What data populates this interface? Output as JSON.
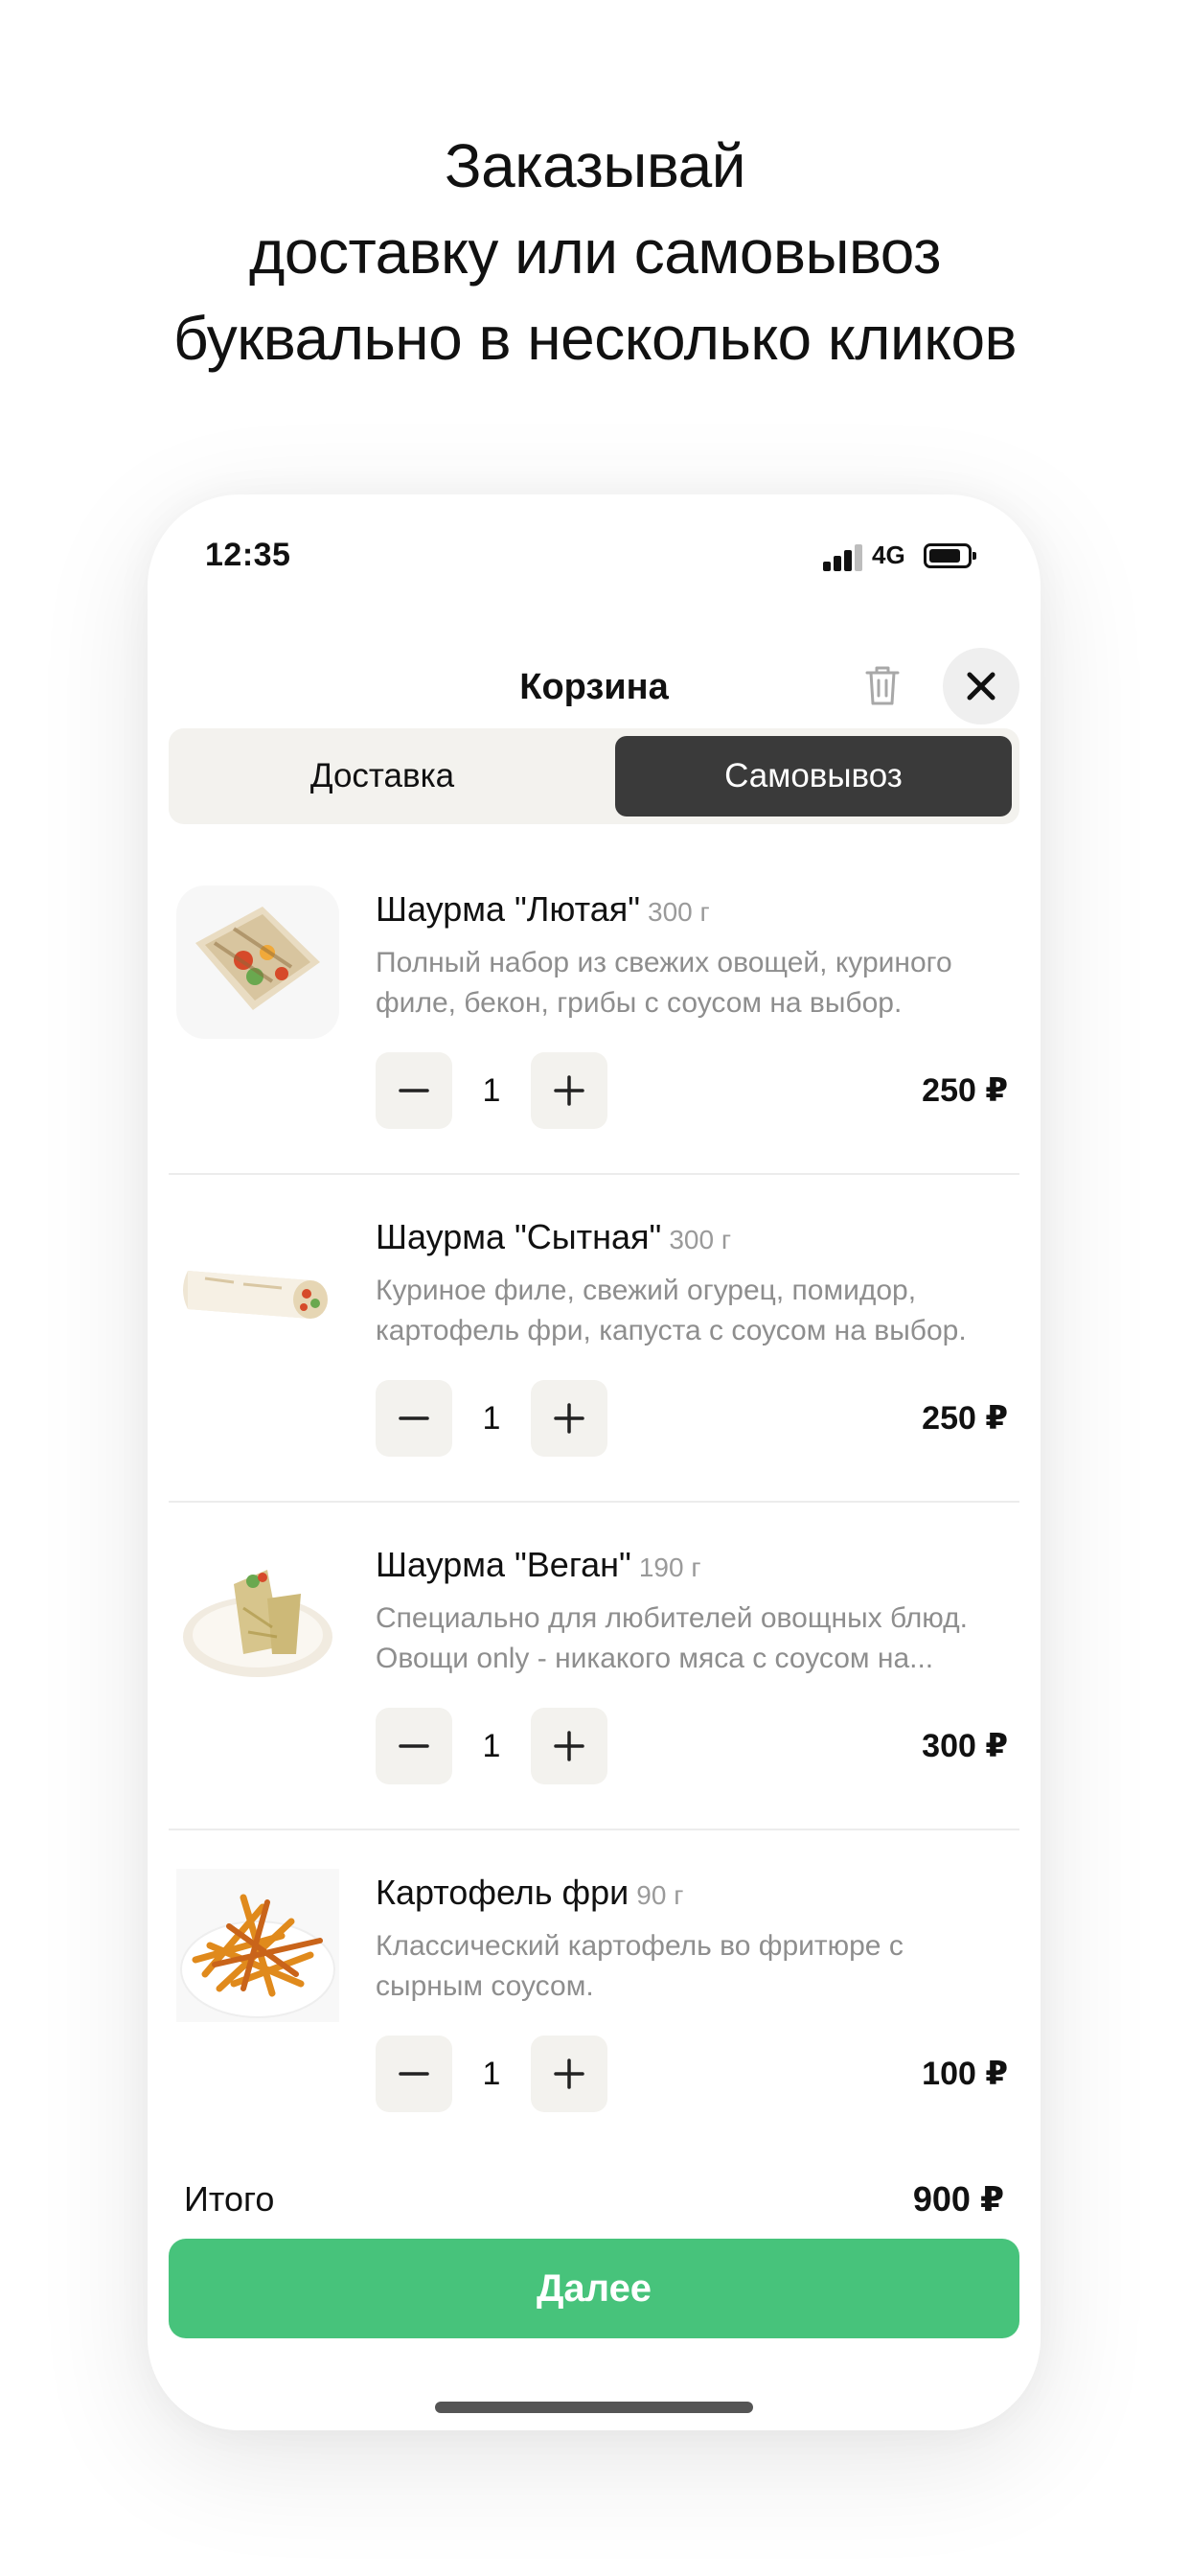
{
  "headline": {
    "line1": "Заказывай",
    "line2": "доставку или самовывоз",
    "line3": "буквально в несколько кликов"
  },
  "status_bar": {
    "time": "12:35",
    "network": "4G"
  },
  "header": {
    "title": "Корзина",
    "trash_icon": "trash-icon",
    "close_icon": "close-icon"
  },
  "tabs": {
    "delivery": "Доставка",
    "pickup": "Самовывоз",
    "active": "pickup"
  },
  "items": [
    {
      "name": "Шаурма \"Лютая\"",
      "weight": "300 г",
      "desc1": "Полный набор из свежих овощей, куриного",
      "desc2": "филе, бекон, грибы с соусом на выбор.",
      "qty": "1",
      "price": "250 ₽"
    },
    {
      "name": "Шаурма \"Сытная\"",
      "weight": "300 г",
      "desc1": "Куриное филе, свежий огурец, помидор,",
      "desc2": "картофель фри, капуста с соусом на выбор.",
      "qty": "1",
      "price": "250 ₽"
    },
    {
      "name": "Шаурма \"Веган\"",
      "weight": "190 г",
      "desc1": "Специально для любителей овощных блюд.",
      "desc2": "Овощи only - никакого мяса с соусом на...",
      "qty": "1",
      "price": "300 ₽"
    },
    {
      "name": "Картофель фри",
      "weight": "90 г",
      "desc1": "Классический картофель во фритюре с",
      "desc2": "сырным соусом.",
      "qty": "1",
      "price": "100 ₽"
    }
  ],
  "footer": {
    "total_label": "Итого",
    "total_value": "900 ₽",
    "next_label": "Далее"
  },
  "colors": {
    "accent": "#47c37b",
    "active_tab": "#3a3a3a",
    "control_bg": "#f3f2ee",
    "muted_text": "#8e8e8e"
  }
}
